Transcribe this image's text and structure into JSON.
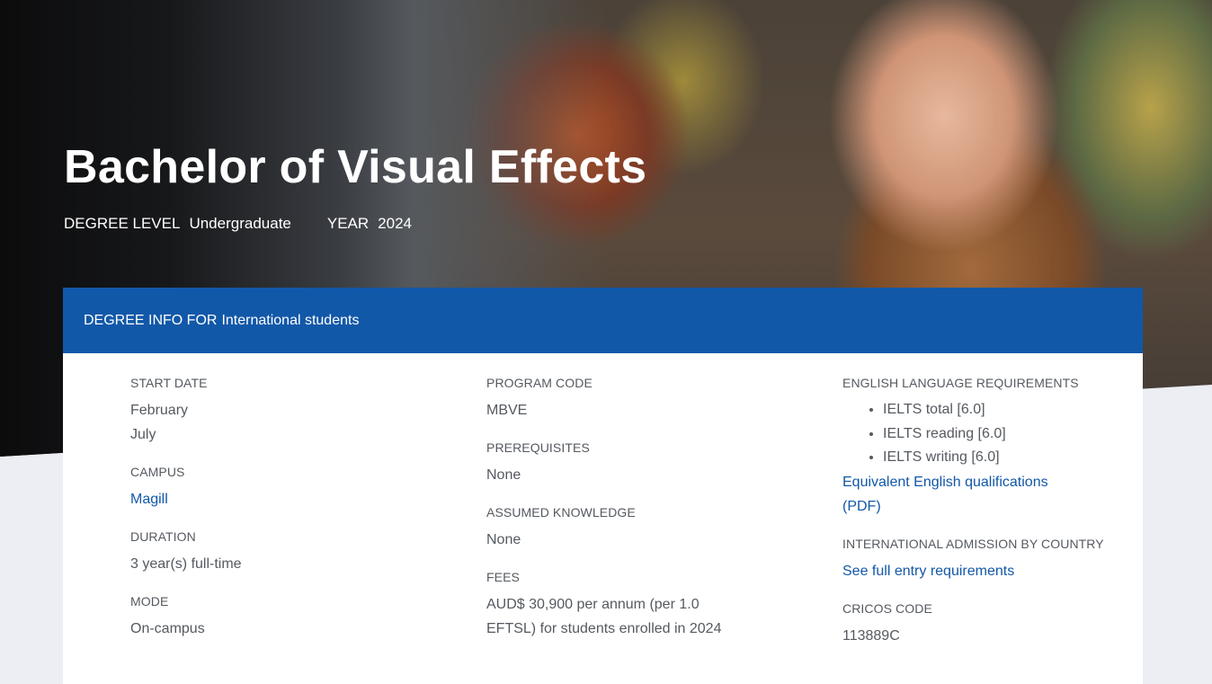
{
  "hero": {
    "title": "Bachelor of Visual Effects",
    "degree_level_label": "DEGREE LEVEL",
    "degree_level_value": "Undergraduate",
    "year_label": "YEAR",
    "year_value": "2024"
  },
  "card": {
    "header_prefix": "DEGREE INFO FOR",
    "header_audience": "International students",
    "start_date": {
      "label": "START DATE",
      "values": [
        "February",
        "July"
      ]
    },
    "campus": {
      "label": "CAMPUS",
      "value": "Magill"
    },
    "duration": {
      "label": "DURATION",
      "value": "3 year(s) full-time"
    },
    "mode": {
      "label": "MODE",
      "value": "On-campus"
    },
    "program_code": {
      "label": "PROGRAM CODE",
      "value": "MBVE"
    },
    "prerequisites": {
      "label": "PREREQUISITES",
      "value": "None"
    },
    "assumed_knowledge": {
      "label": "ASSUMED KNOWLEDGE",
      "value": "None"
    },
    "fees": {
      "label": "FEES",
      "line1": "AUD$ 30,900 per annum (per 1.0",
      "line2": "EFTSL) for students enrolled in 2024"
    },
    "english": {
      "label": "ENGLISH LANGUAGE REQUIREMENTS",
      "items": [
        "IELTS total [6.0]",
        "IELTS reading [6.0]",
        "IELTS writing [6.0]"
      ],
      "link_line1": "Equivalent English qualifications",
      "link_line2": "(PDF)"
    },
    "admission": {
      "label": "INTERNATIONAL ADMISSION BY COUNTRY",
      "link": "See full entry requirements"
    },
    "cricos": {
      "label": "CRICOS CODE",
      "value": "113889C"
    }
  },
  "colors": {
    "header_blue": "#1258a8",
    "link_blue": "#1258a8",
    "text_gray": "#555a60",
    "page_bg": "#eceef3"
  }
}
